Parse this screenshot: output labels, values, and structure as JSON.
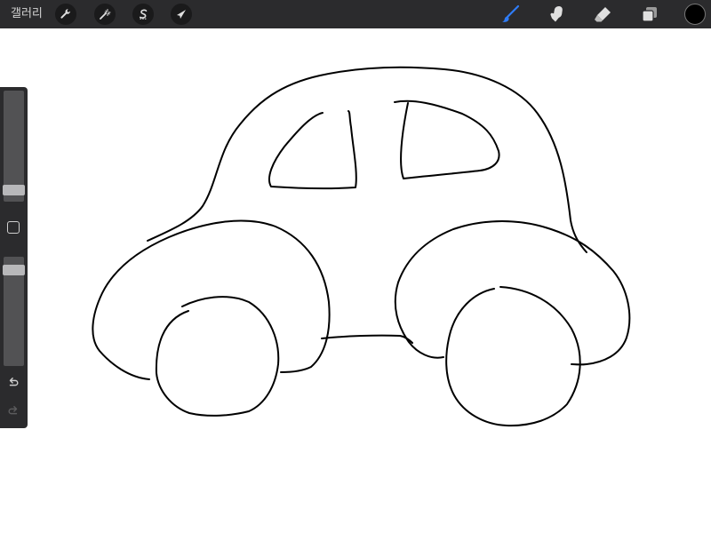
{
  "toolbar": {
    "gallery_label": "갤러리",
    "left_tools": [
      {
        "name": "actions",
        "icon": "wrench-icon"
      },
      {
        "name": "adjustments",
        "icon": "magic-wand-icon"
      },
      {
        "name": "selection",
        "icon": "selection-s-icon"
      },
      {
        "name": "transform",
        "icon": "arrow-cursor-icon"
      }
    ],
    "right_tools": [
      {
        "name": "brush",
        "icon": "brush-icon",
        "active": true,
        "color": "#2f7cf6"
      },
      {
        "name": "smudge",
        "icon": "smudge-finger-icon",
        "active": false
      },
      {
        "name": "eraser",
        "icon": "eraser-icon",
        "active": false
      },
      {
        "name": "layers",
        "icon": "layers-icon",
        "active": false
      }
    ],
    "current_color": "#000000"
  },
  "sidebar": {
    "brush_size_level": 0.94,
    "opacity_level": 0.08,
    "modify_icon": "square-icon",
    "undo_icon": "undo-arrow-icon",
    "redo_icon": "redo-arrow-icon",
    "redo_enabled": false
  },
  "canvas": {
    "background": "#ffffff",
    "stroke_color": "#000000",
    "drawing_subject": "car-sketch"
  }
}
